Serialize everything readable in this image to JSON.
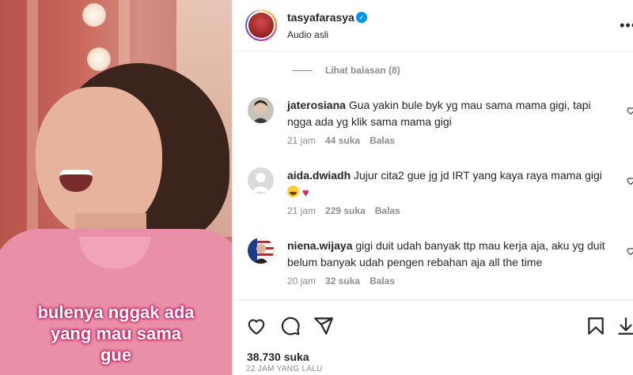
{
  "media": {
    "caption_lines": [
      "bulenya nggak ada",
      "yang mau sama",
      "gue"
    ]
  },
  "post": {
    "username": "tasyafarasya",
    "verified_icon": "verified-badge-icon",
    "audio": "Audio asli",
    "more_icon": "more-options-icon"
  },
  "view_replies": "Lihat balasan (8)",
  "comments": [
    {
      "user": "jaterosiana",
      "text": "Gua yakin bule byk yg mau sama mama gigi, tapi ngga ada yg klik sama mama gigi",
      "time": "21 jam",
      "likes": "44 suka",
      "reply": "Balas"
    },
    {
      "user": "aida.dwiadh",
      "text": "Jujur cita2 gue jg jd IRT yang kaya raya mama gigi",
      "emojis": [
        "laughing-tears-emoji",
        "red-heart-emoji"
      ],
      "time": "21 jam",
      "likes": "229 suka",
      "reply": "Balas"
    },
    {
      "user": "niena.wijaya",
      "text": "gigi duit udah banyak ttp mau kerja aja, aku yg duit belum banyak udah pengen rebahan aja all the time",
      "time": "20 jam",
      "likes": "32 suka",
      "reply": "Balas"
    }
  ],
  "actions": {
    "like_icon": "heart-icon",
    "comment_icon": "comment-icon",
    "share_icon": "share-icon",
    "save_icon": "bookmark-icon",
    "download_icon": "download-icon"
  },
  "likes_count": "38.730 suka",
  "posted_ago": "22 JAM YANG LALU",
  "colors": {
    "accent_blue": "#0095f6",
    "text_primary": "#262626",
    "text_secondary": "#8e8e8e",
    "caption_text": "#ffffff",
    "caption_outline": "#c2185b"
  }
}
